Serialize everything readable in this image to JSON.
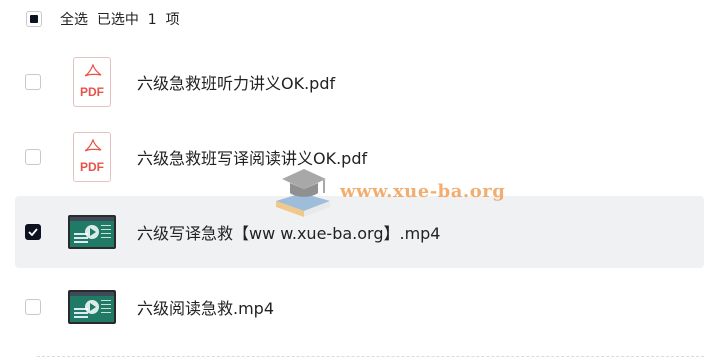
{
  "header": {
    "select_all_label": "全选",
    "selected_summary": "已选中  1  项"
  },
  "files": [
    {
      "name": "六级急救班听力讲义OK.pdf",
      "type": "pdf",
      "icon_label": "PDF",
      "checked": false
    },
    {
      "name": "六级急救班写译阅读讲义OK.pdf",
      "type": "pdf",
      "icon_label": "PDF",
      "checked": false
    },
    {
      "name": "六级写译急救【ww w.xue-ba.org】.mp4",
      "type": "video",
      "checked": true
    },
    {
      "name": "六级阅读急救.mp4",
      "type": "video",
      "checked": false
    }
  ],
  "watermark": {
    "text": "www.xue-ba.org",
    "icon": "graduation-cap-book-icon"
  },
  "colors": {
    "accent": "#0e1120",
    "pdf_red": "#e8534a",
    "selected_row_bg": "#f0f1f3",
    "watermark": "#f0a05a"
  }
}
